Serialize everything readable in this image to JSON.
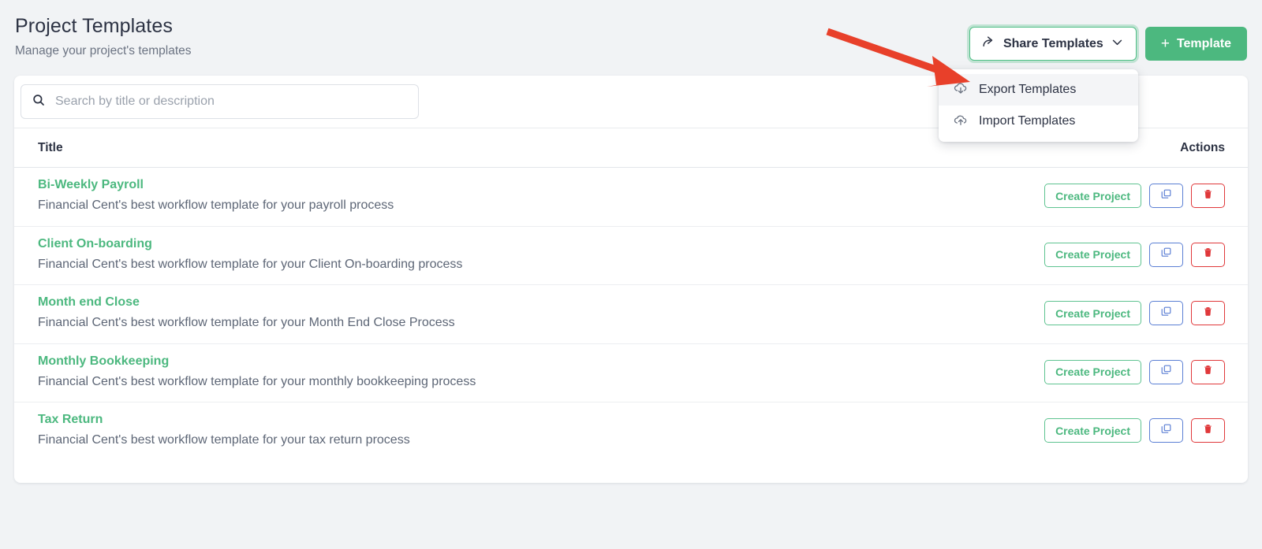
{
  "header": {
    "title": "Project Templates",
    "subtitle": "Manage your project's templates",
    "share_button": {
      "label": "Share Templates",
      "icon": "share-arrow-icon",
      "chevron": "chevron-down-icon",
      "focus_ring_color": "#4fbf86"
    },
    "template_button": {
      "label": "Template",
      "plus": "+",
      "background": "#4cb87f"
    }
  },
  "dropdown": {
    "items": [
      {
        "label": "Export Templates",
        "icon": "cloud-download-icon",
        "hovered": true
      },
      {
        "label": "Import Templates",
        "icon": "cloud-upload-icon",
        "hovered": false
      }
    ]
  },
  "search": {
    "placeholder": "Search by title or description",
    "value": "",
    "icon": "search-icon"
  },
  "table": {
    "columns": [
      "Title",
      "Actions"
    ],
    "action_labels": {
      "create": "Create Project",
      "duplicate_icon": "copy-icon",
      "delete_icon": "trash-icon"
    },
    "rows": [
      {
        "title": "Bi-Weekly Payroll",
        "description": "Financial Cent's best workflow template for your payroll process"
      },
      {
        "title": "Client On-boarding",
        "description": "Financial Cent's best workflow template for your Client On-boarding process"
      },
      {
        "title": "Month end Close",
        "description": "Financial Cent's best workflow template for your Month End Close Process"
      },
      {
        "title": "Monthly Bookkeeping",
        "description": "Financial Cent's best workflow template for your monthly bookkeeping process"
      },
      {
        "title": "Tax Return",
        "description": "Financial Cent's best workflow template for your tax return process"
      }
    ]
  },
  "annotation": {
    "arrow": {
      "color": "#e8402a",
      "points_to": "Export Templates"
    }
  },
  "colors": {
    "brand_green": "#4cb87f",
    "page_background": "#f1f3f5",
    "text_dark": "#2c3243",
    "text_muted": "#5d6676",
    "blue_outline": "#5b7fd4",
    "red_outline": "#e0383a"
  }
}
